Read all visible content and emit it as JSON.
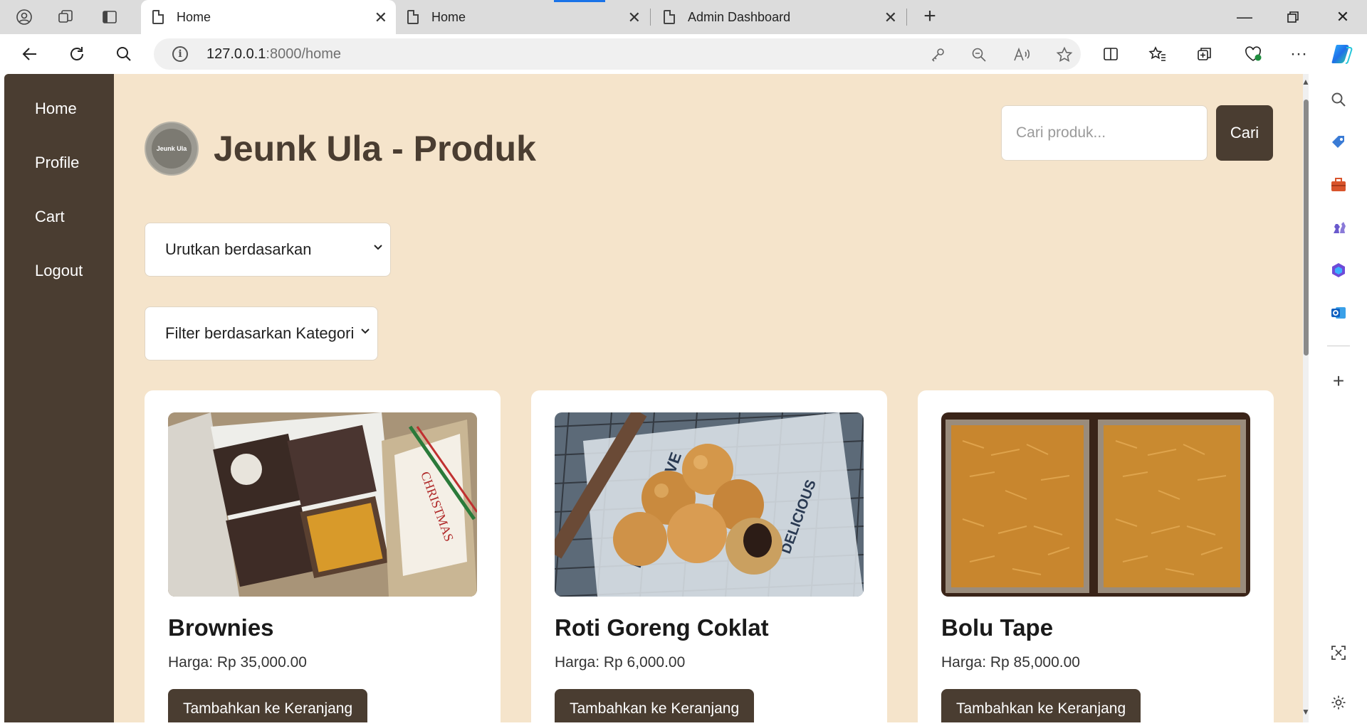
{
  "browser": {
    "tabs": [
      {
        "title": "Home",
        "active": true
      },
      {
        "title": "Home",
        "active": false
      },
      {
        "title": "Admin Dashboard",
        "active": false
      }
    ],
    "address": {
      "host": "127.0.0.1",
      "rest": ":8000/home"
    }
  },
  "sidebar": {
    "items": [
      {
        "label": "Home"
      },
      {
        "label": "Profile"
      },
      {
        "label": "Cart"
      },
      {
        "label": "Logout"
      }
    ]
  },
  "header": {
    "logo_text": "Jeunk Ula",
    "title": "Jeunk Ula - Produk",
    "search_placeholder": "Cari produk...",
    "search_button": "Cari"
  },
  "filters": {
    "sort_label": "Urutkan berdasarkan",
    "category_label": "Filter berdasarkan Kategori"
  },
  "products": [
    {
      "name": "Brownies",
      "price": "Harga: Rp 35,000.00",
      "button": "Tambahkan ke Keranjang"
    },
    {
      "name": "Roti Goreng Coklat",
      "price": "Harga: Rp 6,000.00",
      "button": "Tambahkan ke Keranjang"
    },
    {
      "name": "Bolu Tape",
      "price": "Harga: Rp 85,000.00",
      "button": "Tambahkan ke Keranjang"
    }
  ],
  "colors": {
    "page_background": "#f5e4cb",
    "sidebar": "#4a3d31",
    "accent": "#4a3d31"
  }
}
